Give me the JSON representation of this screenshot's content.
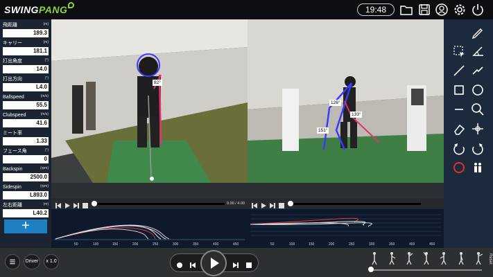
{
  "header": {
    "brand_main": "SWING",
    "brand_accent": "PANG",
    "time": "19:48",
    "icons": [
      "folder-icon",
      "save-icon",
      "user-icon",
      "gear-icon",
      "power-icon"
    ]
  },
  "stats": [
    {
      "label": "飛距離",
      "unit": "(m)",
      "value": "189.3"
    },
    {
      "label": "キャリー",
      "unit": "(m)",
      "value": "181.1"
    },
    {
      "label": "打出角度",
      "unit": "(°)",
      "value": "14.0"
    },
    {
      "label": "打出方向",
      "unit": "(°)",
      "value": "L4.0"
    },
    {
      "label": "Ballspeed",
      "unit": "(m/s)",
      "value": "55.5"
    },
    {
      "label": "Clubspeed",
      "unit": "(m/s)",
      "value": "41.6"
    },
    {
      "label": "ミート率",
      "unit": "",
      "value": "1.33"
    },
    {
      "label": "フェース角",
      "unit": "(°)",
      "value": "0"
    },
    {
      "label": "Backspin",
      "unit": "(rpm)",
      "value": "2500.0"
    },
    {
      "label": "Sidespin",
      "unit": "(rpm)",
      "value": "L893.0"
    },
    {
      "label": "左右距離",
      "unit": "(m)",
      "value": "L40.2"
    }
  ],
  "add_button": "+",
  "video_left": {
    "angle": "82°"
  },
  "video_right": {
    "angles": [
      "126°",
      "133°",
      "151°"
    ]
  },
  "playback_left": {
    "time": "0.00 / 4.00",
    "progress": 0.0
  },
  "trajectory_left": {
    "ticks": [
      "50",
      "100",
      "150",
      "200",
      "250",
      "300",
      "350",
      "400",
      "450"
    ]
  },
  "trajectory_right": {
    "ticks": [
      "50",
      "100",
      "150",
      "200",
      "250",
      "300",
      "350",
      "400",
      "450"
    ]
  },
  "tools": [
    "pen-icon",
    "select-icon",
    "angle-icon",
    "line-icon",
    "zigzag-icon",
    "rectangle-icon",
    "circle-icon",
    "minus-icon",
    "zoom-icon",
    "eraser-icon",
    "move-icon",
    "undo-icon",
    "redo-icon",
    "record-icon",
    "compare-icon"
  ],
  "bottom": {
    "club": "Driver",
    "speed": "x 1.0",
    "reset": "Reset"
  },
  "colors": {
    "accent": "#1f7fc3",
    "brand_accent": "#8fd13f"
  }
}
